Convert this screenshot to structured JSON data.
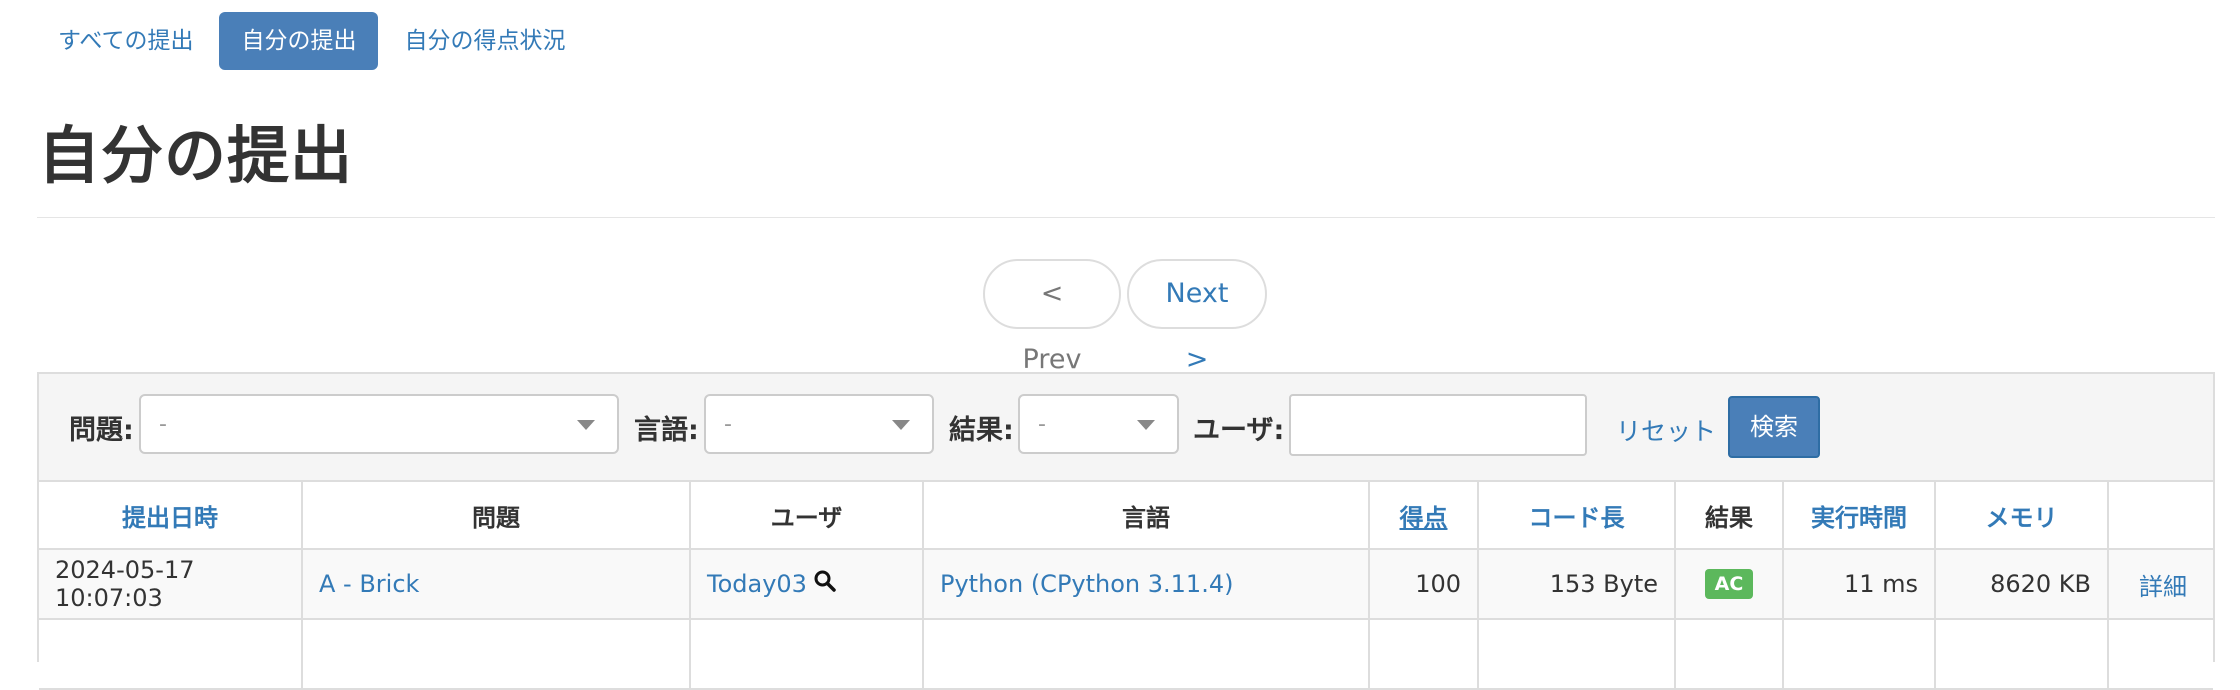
{
  "nav": {
    "items": [
      {
        "label": "すべての提出"
      },
      {
        "label": "自分の提出"
      },
      {
        "label": "自分の得点状況"
      }
    ]
  },
  "page": {
    "title": "自分の提出"
  },
  "pager": {
    "prev": "< Prev",
    "next": "Next >"
  },
  "filters": {
    "problem_label": "問題:",
    "problem_value": "-",
    "language_label": "言語:",
    "language_value": "-",
    "result_label": "結果:",
    "result_value": "-",
    "user_label": "ユーザ:",
    "user_value": "",
    "reset": "リセット",
    "search": "検索"
  },
  "table": {
    "headers": [
      "提出日時",
      "問題",
      "ユーザ",
      "言語",
      "得点",
      "コード長",
      "結果",
      "実行時間",
      "メモリ",
      ""
    ],
    "rows": [
      {
        "date": "2024-05-17 10:07:03",
        "problem": "A - Brick",
        "user": "Today03",
        "language": "Python (CPython 3.11.4)",
        "score": "100",
        "code_length": "153 Byte",
        "result": "AC",
        "time": "11 ms",
        "memory": "8620 KB",
        "detail": "詳細"
      }
    ]
  },
  "colors": {
    "link": "#337ab7",
    "active_pill": "#4a7fb8",
    "ac_badge": "#5cb85c"
  }
}
